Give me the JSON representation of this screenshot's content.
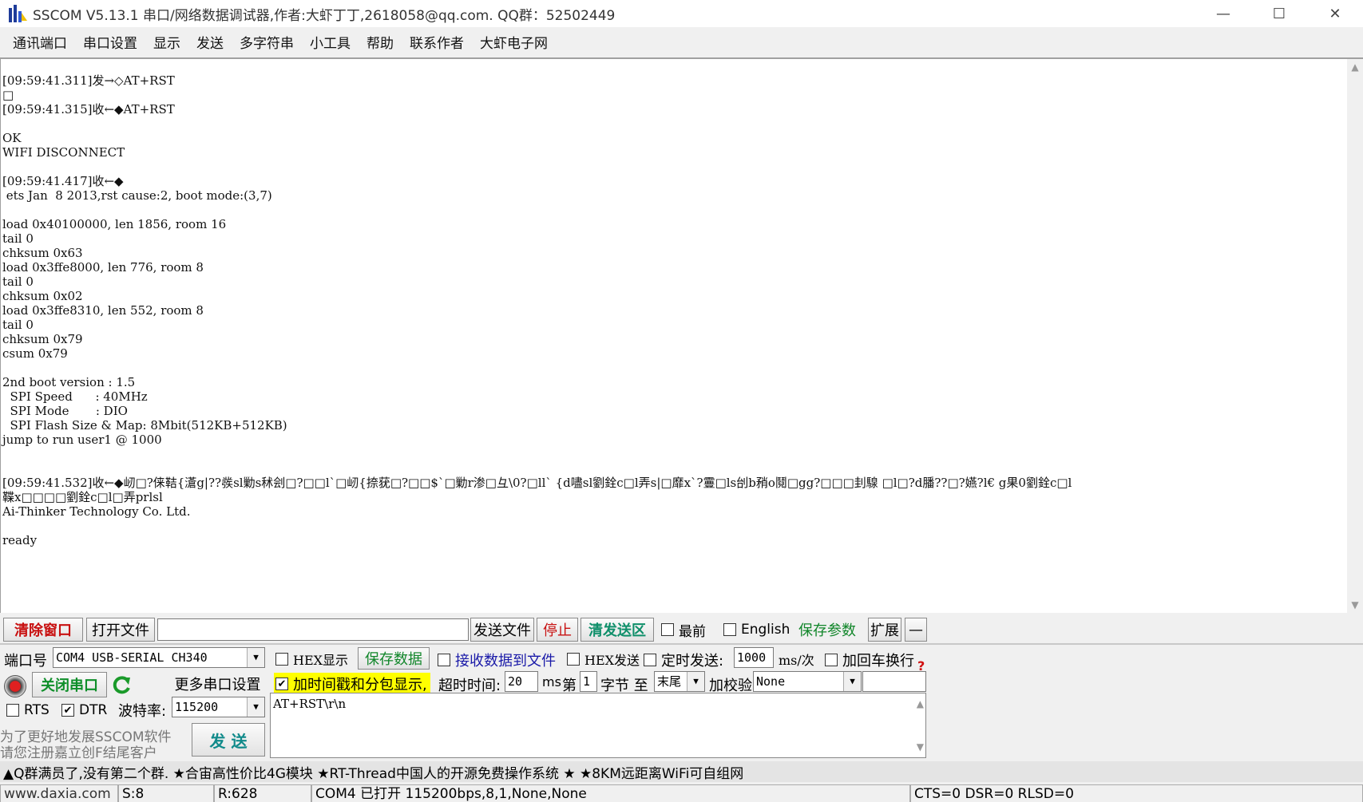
{
  "window": {
    "title": "SSCOM V5.13.1 串口/网络数据调试器,作者:大虾丁丁,2618058@qq.com. QQ群：52502449",
    "minimize": "—",
    "maximize": "☐",
    "close": "✕"
  },
  "menu": [
    "通讯端口",
    "串口设置",
    "显示",
    "发送",
    "多字符串",
    "小工具",
    "帮助",
    "联系作者",
    "大虾电子网"
  ],
  "log": {
    "lines": [
      "[09:59:41.311]发→◇AT+RST",
      "□",
      "[09:59:41.315]收←◆AT+RST",
      "",
      "OK",
      "WIFI DISCONNECT",
      "",
      "[09:59:41.417]收←◆",
      " ets Jan  8 2013,rst cause:2, boot mode:(3,7)",
      "",
      "load 0x40100000, len 1856, room 16",
      "tail 0",
      "chksum 0x63",
      "load 0x3ffe8000, len 776, room 8",
      "tail 0",
      "chksum 0x02",
      "load 0x3ffe8310, len 552, room 8",
      "tail 0",
      "chksum 0x79",
      "csum 0x79",
      "",
      "2nd boot version : 1.5",
      "  SPI Speed      : 40MHz",
      "  SPI Mode       : DIO",
      "  SPI Flash Size & Map: 8Mbit(512KB+512KB)",
      "jump to run user1 @ 1000",
      "",
      "",
      "[09:59:41.532]收←◆屻□?俫鞊{濸g|??彂sl勦s秫刽□?□□l`□屻{捺莸□?□□$`□勦r渗□彑\\0?□ll` {d嚍sl劉銓c□l弄s|□靡x`?霻□ls刣b矟o鬩□gg?□□□刲騡 □l□?d膰??□?嬿?l€ g果0劉銓c□l",
      "鞢x□□□□劉銓c□l□弄prlsl",
      "Ai-Thinker Technology Co. Ltd.",
      "",
      "ready"
    ]
  },
  "toolbar": {
    "clear_window": "清除窗口",
    "open_file": "打开文件",
    "file_path": "",
    "send_file": "发送文件",
    "stop": "停止",
    "clear_send": "清发送区",
    "topmost": "最前",
    "english": "English",
    "save_params": "保存参数",
    "expand": "扩展",
    "collapse": "—"
  },
  "port": {
    "port_label": "端口号",
    "port_value": "COM4 USB-SERIAL CH340",
    "close_port": "关闭串口",
    "more_settings": "更多串口设置",
    "rts": "RTS",
    "dtr": "DTR",
    "baud_label": "波特率:",
    "baud_value": "115200",
    "promo1": "为了更好地发展SSCOM软件",
    "promo2": "请您注册嘉立创F结尾客户",
    "send": "发 送"
  },
  "options": {
    "hex_display": "HEX显示",
    "save_data": "保存数据",
    "recv_to_file": "接收数据到文件",
    "hex_send": "HEX发送",
    "timed_send": "定时发送:",
    "interval": "1000",
    "interval_unit": "ms/次",
    "add_crlf": "加回车换行",
    "timestamp": "加时间戳和分包显示,",
    "timeout_label": "超时时间:",
    "timeout_value": "20",
    "timeout_unit": "ms",
    "byte_label_pre": "第",
    "byte_from": "1",
    "byte_label_mid": "字节 至",
    "byte_to": "末尾",
    "checksum_label": "加校验",
    "checksum_value": "None",
    "help": "?"
  },
  "send_area": {
    "text": "AT+RST\\r\\n"
  },
  "adbar": "▲Q群满员了,没有第二个群. ★合宙高性价比4G模块 ★RT-Thread中国人的开源免费操作系统 ★ ★8KM远距离WiFi可自组网",
  "status": {
    "website": "www.daxia.com",
    "sent": "S:8",
    "received": "R:628",
    "port_info": "COM4 已打开  115200bps,8,1,None,None",
    "lines": "CTS=0 DSR=0 RLSD=0"
  },
  "colors": {
    "accent_red": "#c81010",
    "accent_green": "#11862a",
    "highlight_yellow": "#ffff00",
    "link_blue": "#1a1aa8"
  }
}
